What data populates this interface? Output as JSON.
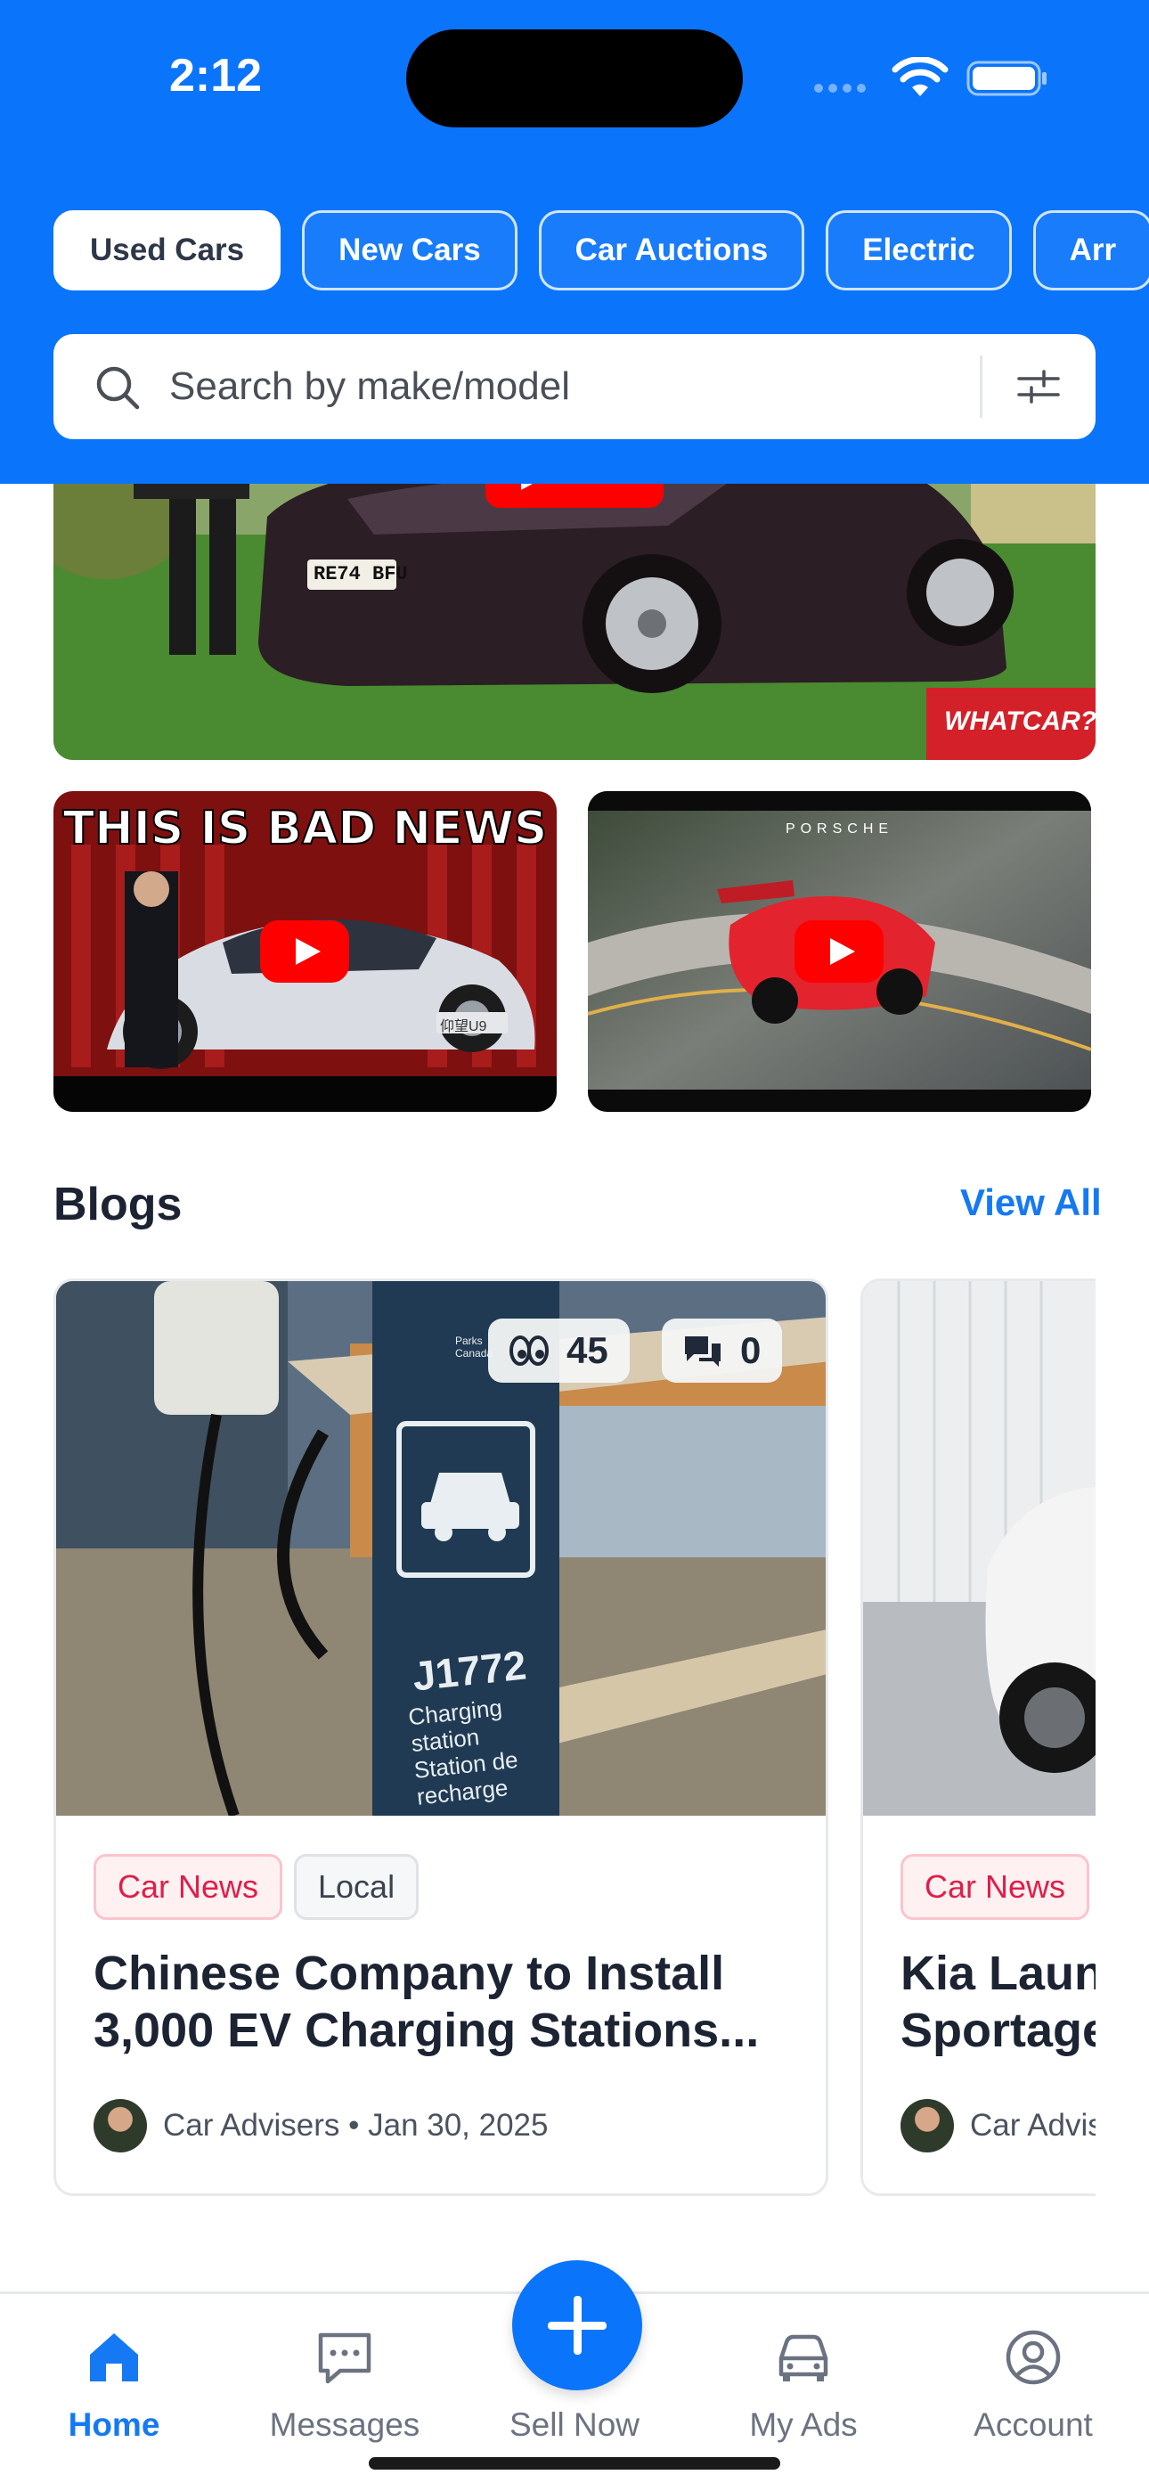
{
  "status_bar": {
    "time": "2:12"
  },
  "tabs": [
    {
      "label": "Used Cars",
      "active": true
    },
    {
      "label": "New Cars",
      "active": false
    },
    {
      "label": "Car Auctions",
      "active": false
    },
    {
      "label": "Electric",
      "active": false
    },
    {
      "label": "Arr",
      "active": false
    }
  ],
  "search": {
    "placeholder": "Search by make/model"
  },
  "videos": {
    "main": {
      "plate": "RE74 BFU",
      "badge": "WHATCAR?"
    },
    "small_1": {
      "headline": "THIS IS BAD NEWS",
      "plate": "仰望U9"
    },
    "small_2": {
      "brand": "PORSCHE"
    }
  },
  "blogs": {
    "title": "Blogs",
    "view_all": "View All",
    "cards": [
      {
        "views": "45",
        "comments": "0",
        "sign_label": "J1772",
        "sign_sub1": "Charging",
        "sign_sub2": "station",
        "sign_sub3": "Station de",
        "sign_sub4": "recharge",
        "sign_parks": "Parks Canada",
        "tags": [
          "Car News",
          "Local"
        ],
        "title": "Chinese Company to Install 3,000 EV Charging Stations...",
        "author": "Car Advisers",
        "date": "Jan 30, 2025",
        "meta": "Car Advisers • Jan 30, 2025"
      },
      {
        "tags": [
          "Car News"
        ],
        "title": "Kia Laun Sportage",
        "title_line1": "Kia Laun",
        "title_line2": "Sportage",
        "author": "Car Advis"
      }
    ]
  },
  "bottom_nav": {
    "items": [
      {
        "label": "Home",
        "icon": "home-icon",
        "active": true
      },
      {
        "label": "Messages",
        "icon": "messages-icon",
        "active": false
      },
      {
        "label": "Sell Now",
        "icon": "plus-icon",
        "active": false
      },
      {
        "label": "My Ads",
        "icon": "car-icon",
        "active": false
      },
      {
        "label": "Account",
        "icon": "account-icon",
        "active": false
      }
    ]
  },
  "colors": {
    "brand": "#0a74fb",
    "link": "#1579f3",
    "tag_news": "#e11d48"
  }
}
